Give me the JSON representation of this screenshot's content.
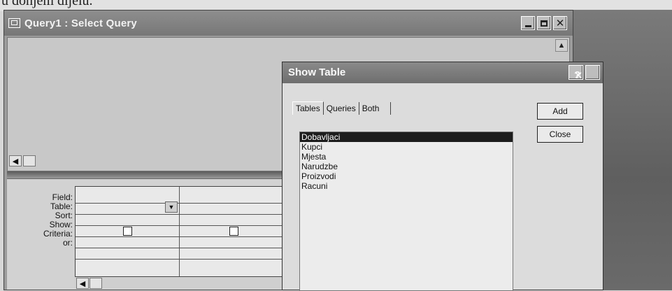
{
  "page_text": "u donjem dijelu.",
  "query_window": {
    "title": "Query1 : Select Query",
    "grid_labels": [
      "Field:",
      "Table:",
      "Sort:",
      "Show:",
      "Criteria:",
      "or:"
    ]
  },
  "dialog": {
    "title": "Show Table",
    "help_label": "?",
    "tabs": [
      "Tables",
      "Queries",
      "Both"
    ],
    "tables": [
      "Dobavljaci",
      "Kupci",
      "Mjesta",
      "Narudzbe",
      "Proizvodi",
      "Racuni"
    ],
    "selected_index": 0,
    "add_label": "Add",
    "close_label": "Close"
  },
  "icons": {
    "close": "✕",
    "scroll_up": "▲",
    "scroll_left": "◀",
    "dropdown": "▼"
  }
}
